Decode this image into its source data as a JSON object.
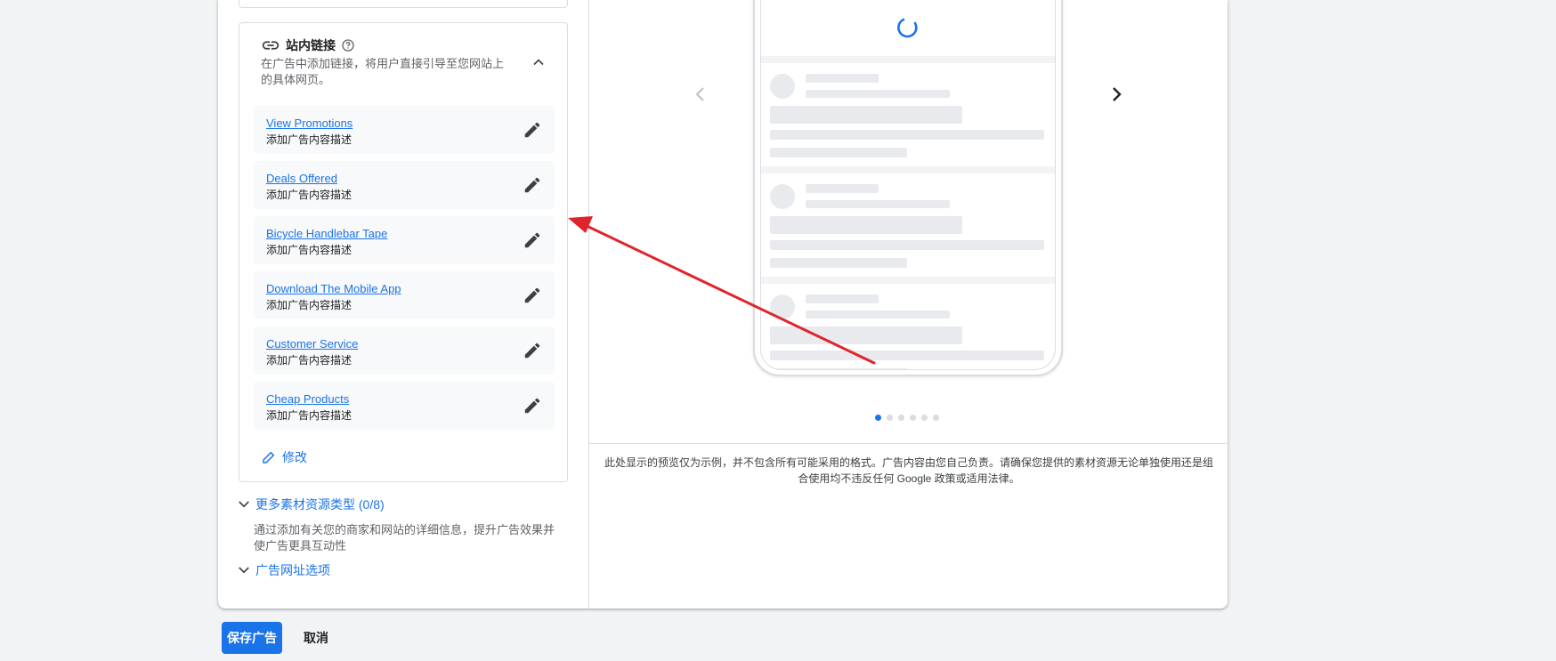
{
  "sitelinks": {
    "title": "站内链接",
    "description": "在广告中添加链接，将用户直接引导至您网站上的具体网页。",
    "items": [
      {
        "link": "View Promotions",
        "sub": "添加广告内容描述"
      },
      {
        "link": "Deals Offered",
        "sub": "添加广告内容描述"
      },
      {
        "link": "Bicycle Handlebar Tape",
        "sub": "添加广告内容描述"
      },
      {
        "link": "Download The Mobile App",
        "sub": "添加广告内容描述"
      },
      {
        "link": "Customer Service",
        "sub": "添加广告内容描述"
      },
      {
        "link": "Cheap Products",
        "sub": "添加广告内容描述"
      }
    ],
    "modify_label": "修改"
  },
  "more_assets": {
    "label": "更多素材资源类型 (0/8)",
    "description": "通过添加有关您的商家和网站的详细信息，提升广告效果并使广告更具互动性"
  },
  "url_options": {
    "label": "广告网址选项"
  },
  "preview": {
    "disclaimer": "此处显示的预览仅为示例，并不包含所有可能采用的格式。广告内容由您自己负责。请确保您提供的素材资源无论单独使用还是组合使用均不违反任何 Google 政策或适用法律。",
    "page_count": 6,
    "active_page": 1
  },
  "actions": {
    "save": "保存广告",
    "cancel": "取消"
  },
  "colors": {
    "accent": "#1a73e8",
    "annotation_arrow": "#e0242b"
  }
}
